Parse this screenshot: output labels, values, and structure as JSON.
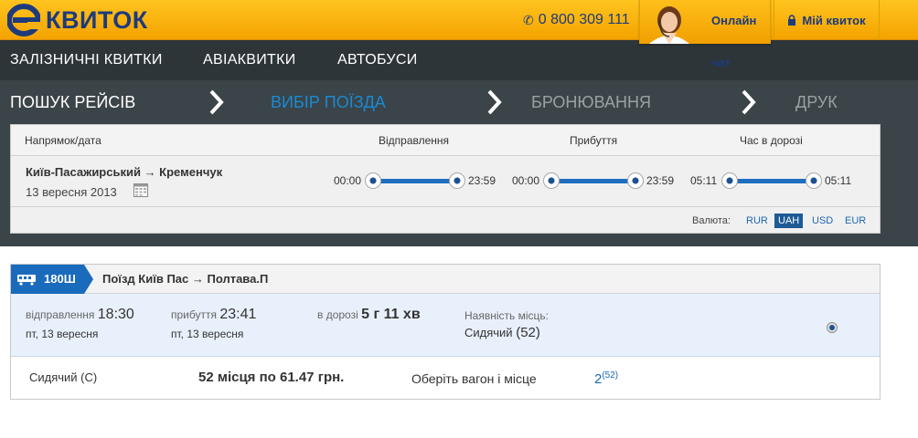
{
  "header": {
    "logo_text": "КВИТОК",
    "phone": "0 800 309 111",
    "chat_label": "Онлайн чат",
    "my_ticket_label": "Мій квиток",
    "brand_color": "#f5a800",
    "brand_dark": "#1d3a7c"
  },
  "nav": {
    "items": [
      {
        "label": "ЗАЛІЗНИЧНІ КВИТКИ"
      },
      {
        "label": "АВІАКВИТКИ"
      },
      {
        "label": "АВТОБУСИ"
      }
    ]
  },
  "steps": {
    "items": [
      {
        "label": "ПОШУК РЕЙСІВ",
        "state": "done"
      },
      {
        "label": "ВИБІР ПОЇЗДА",
        "state": "active"
      },
      {
        "label": "БРОНЮВАННЯ",
        "state": "inactive"
      },
      {
        "label": "ДРУК",
        "state": "inactive"
      }
    ],
    "active_color": "#1a8ad4"
  },
  "filter": {
    "headers": {
      "direction": "Напрямок/дата",
      "departure": "Відправлення",
      "arrival": "Прибуття",
      "duration": "Час в дорозі"
    },
    "route": "Київ-Пасажирський → Кременчук",
    "date": "13 вересня 2013",
    "sliders": {
      "departure": {
        "min": "00:00",
        "max": "23:59"
      },
      "arrival": {
        "min": "00:00",
        "max": "23:59"
      },
      "duration": {
        "min": "05:11",
        "max": "05:11"
      }
    },
    "currency_label": "Валюта:",
    "currencies": [
      "RUR",
      "UAH",
      "USD",
      "EUR"
    ],
    "selected_currency": "UAH"
  },
  "train": {
    "number": "180Ш",
    "title": "Поїзд  Київ Пас → Полтава.П",
    "departure_label": "відправлення",
    "departure_time": "18:30",
    "departure_date": "пт, 13 вересня",
    "arrival_label": "прибуття",
    "arrival_time": "23:41",
    "arrival_date": "пт, 13 вересня",
    "duration_label": "в дорозі",
    "duration": "5 г 11 хв",
    "availability_label": "Наявність місць:",
    "availability_type": "Сидячий",
    "availability_count": "(52)",
    "seat_row": {
      "type": "Сидячий (С)",
      "price_text": "52 місця по 61.47 грн.",
      "choose_label": "Оберіть вагон і місце",
      "wagon": "2",
      "wagon_seats": "(52)"
    }
  }
}
